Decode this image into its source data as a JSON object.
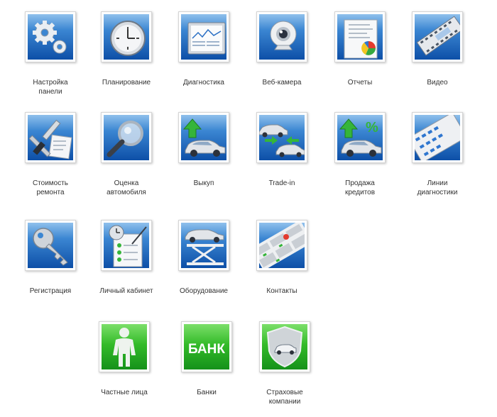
{
  "tiles": [
    {
      "label": "Настройка\nпанели",
      "icon": "gears-icon"
    },
    {
      "label": "Планирование",
      "icon": "clock-icon"
    },
    {
      "label": "Диагностика",
      "icon": "monitor-chart-icon"
    },
    {
      "label": "Веб-камера",
      "icon": "webcam-icon"
    },
    {
      "label": "Отчеты",
      "icon": "report-icon"
    },
    {
      "label": "Видео",
      "icon": "film-strip-icon"
    },
    {
      "label": "Стоимость\nремонта",
      "icon": "tools-icon"
    },
    {
      "label": "Оценка\nавтомобиля",
      "icon": "magnifier-icon"
    },
    {
      "label": "Выкуп",
      "icon": "car-buyback-icon"
    },
    {
      "label": "Trade-in",
      "icon": "car-exchange-icon"
    },
    {
      "label": "Продажа\nкредитов",
      "icon": "car-credit-icon"
    },
    {
      "label": "Линии\nдиагностики",
      "icon": "diagnostic-lines-icon"
    },
    {
      "label": "Регистрация",
      "icon": "key-icon"
    },
    {
      "label": "Личный кабинет",
      "icon": "clipboard-checklist-icon"
    },
    {
      "label": "Оборудование",
      "icon": "car-lift-icon"
    },
    {
      "label": "Контакты",
      "icon": "map-icon"
    },
    {
      "label": "Частные лица",
      "icon": "person-icon"
    },
    {
      "label": "Банки",
      "icon": "bank-icon",
      "text": "БАНК"
    },
    {
      "label": "Страховые\nкомпании",
      "icon": "shield-car-icon"
    }
  ],
  "colors": {
    "blue": "#0d4fa7",
    "green": "#22a81f",
    "label": "#333333"
  }
}
